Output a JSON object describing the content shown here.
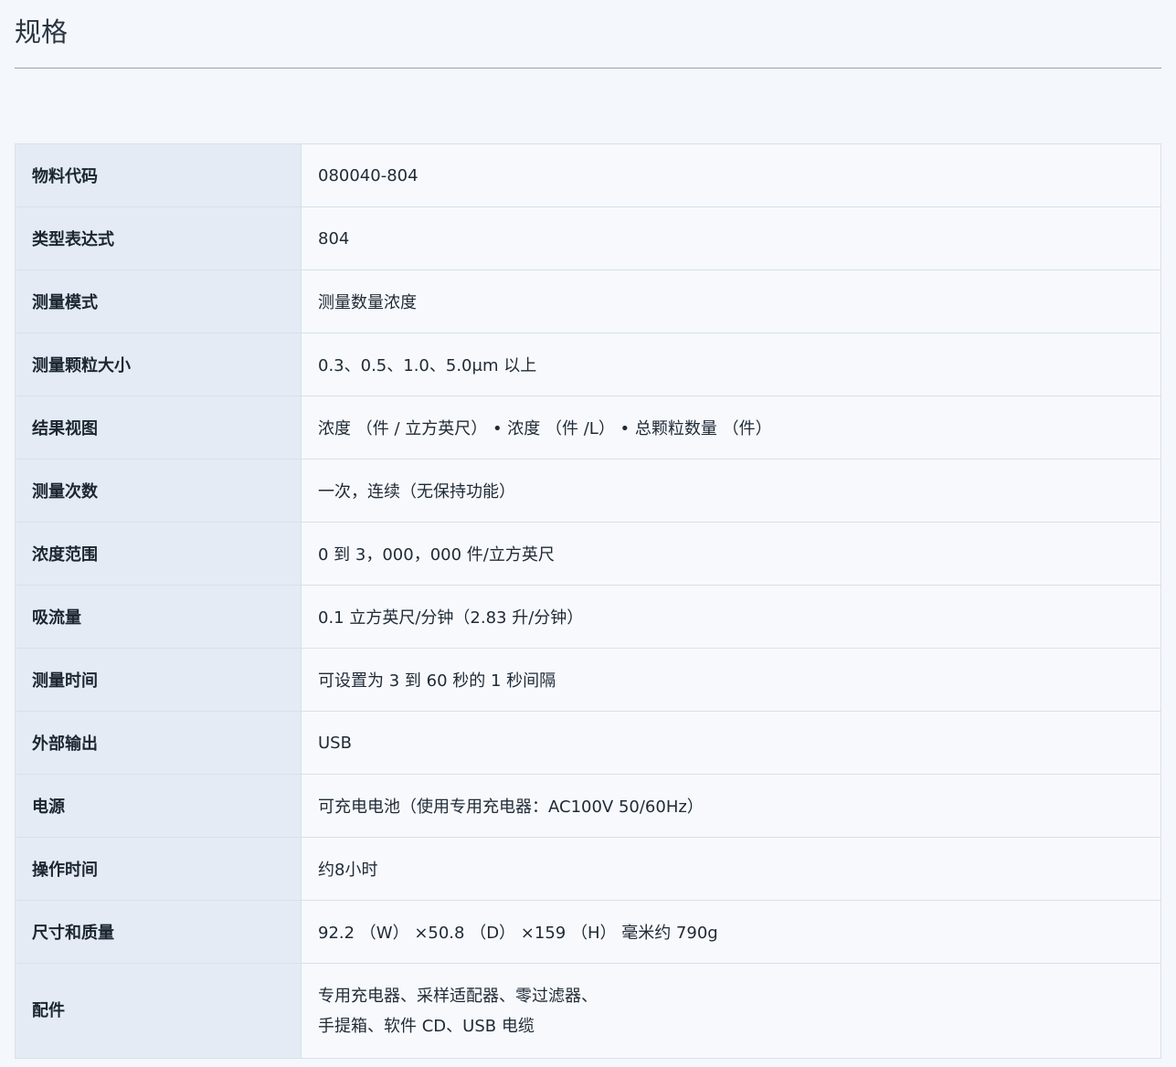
{
  "page": {
    "title": "规格"
  },
  "specs": [
    {
      "label": "物料代码",
      "value": "080040-804"
    },
    {
      "label": "类型表达式",
      "value": "804"
    },
    {
      "label": "测量模式",
      "value": "测量数量浓度"
    },
    {
      "label": "测量颗粒大小",
      "value": "0.3、0.5、1.0、5.0μm 以上"
    },
    {
      "label": "结果视图",
      "value": "浓度 （件 / 立方英尺） • 浓度 （件 /L） • 总颗粒数量 （件）"
    },
    {
      "label": "测量次数",
      "value": "一次，连续（无保持功能）"
    },
    {
      "label": "浓度范围",
      "value": "0 到 3，000，000 件/立方英尺"
    },
    {
      "label": "吸流量",
      "value": "0.1 立方英尺/分钟（2.83 升/分钟）"
    },
    {
      "label": "测量时间",
      "value": "可设置为 3 到 60 秒的 1 秒间隔"
    },
    {
      "label": "外部输出",
      "value": "USB"
    },
    {
      "label": "电源",
      "value": "可充电电池（使用专用充电器：AC100V 50/60Hz）"
    },
    {
      "label": "操作时间",
      "value": "约8小时"
    },
    {
      "label": "尺寸和质量",
      "value": "92.2 （W） ×50.8 （D） ×159 （H） 毫米约 790g"
    },
    {
      "label": "配件",
      "value_lines": [
        "专用充电器、采样适配器、零过滤器、",
        "手提箱、软件 CD、USB 电缆"
      ]
    }
  ]
}
